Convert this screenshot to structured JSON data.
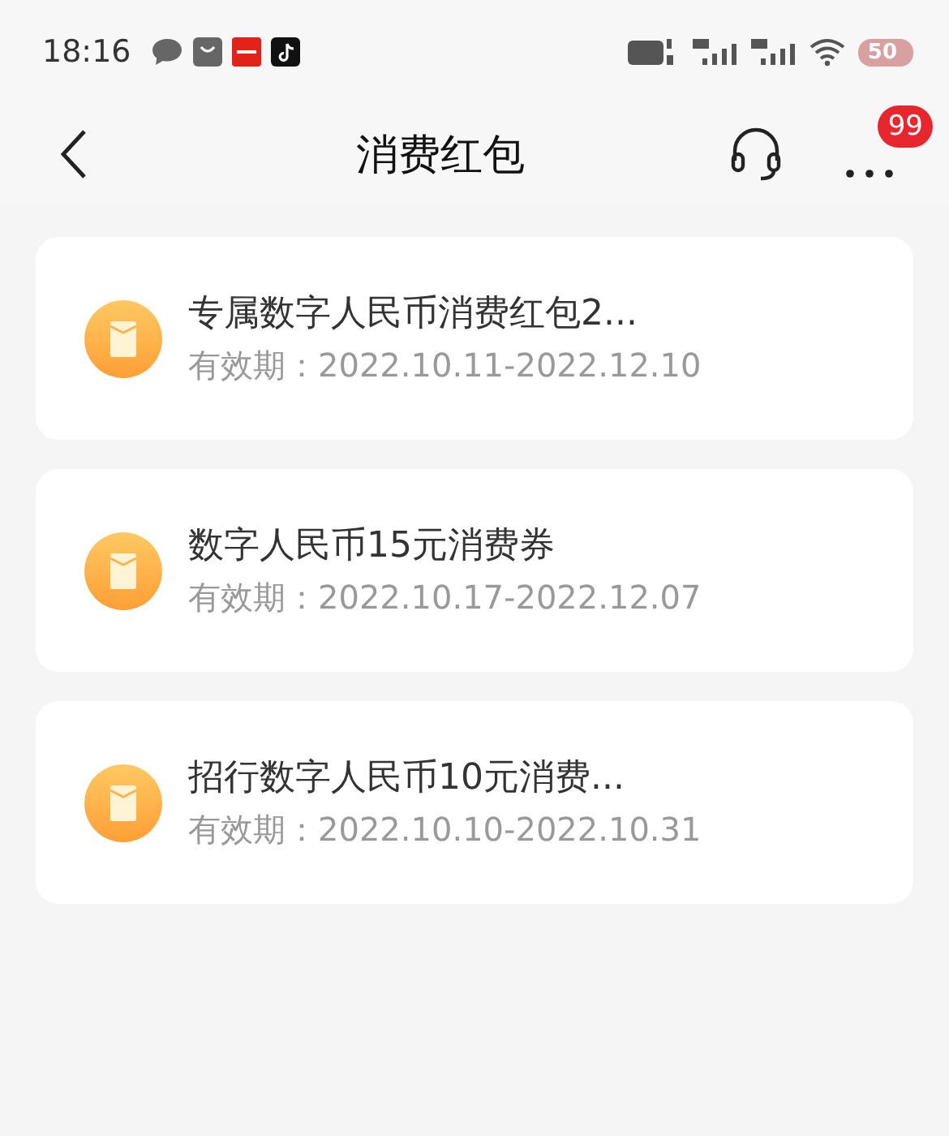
{
  "status_bar": {
    "time": "18:16",
    "battery": "50"
  },
  "header": {
    "title": "消费红包",
    "more_badge": "99"
  },
  "coupons": [
    {
      "name": "专属数字人民币消费红包2...",
      "validity": "有效期：2022.10.11-2022.12.10"
    },
    {
      "name": "数字人民币15元消费券",
      "validity": "有效期：2022.10.17-2022.12.07"
    },
    {
      "name": "招行数字人民币10元消费...",
      "validity": "有效期：2022.10.10-2022.10.31"
    }
  ]
}
